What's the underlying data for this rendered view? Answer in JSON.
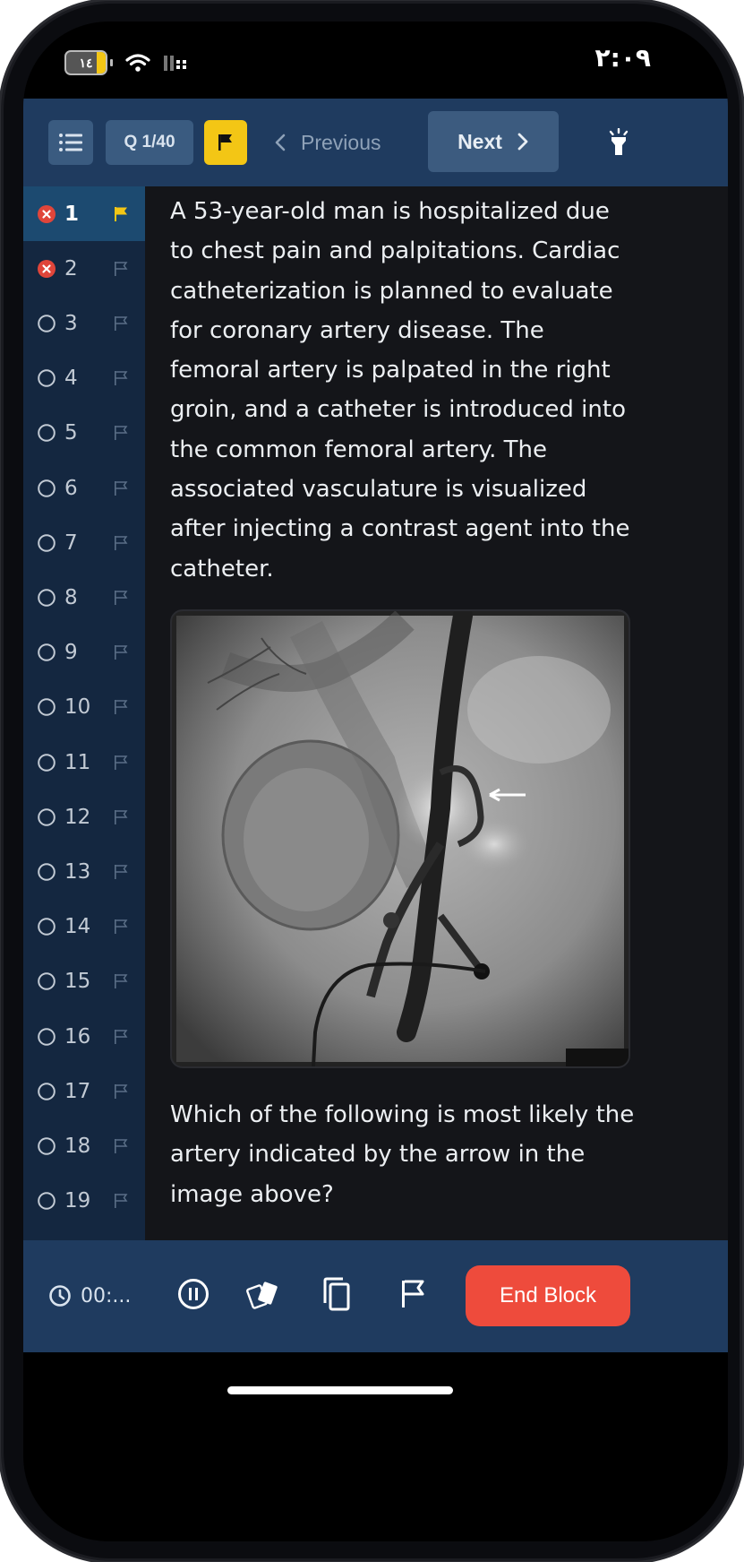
{
  "status_bar": {
    "time": "٢:٠٩",
    "battery_label": "١٤"
  },
  "toolbar": {
    "question_counter": "Q 1/40",
    "previous_label": "Previous",
    "next_label": "Next"
  },
  "sidebar": {
    "items": [
      {
        "number": "1",
        "status": "incorrect",
        "flagged": true,
        "active": true
      },
      {
        "number": "2",
        "status": "incorrect",
        "flagged": false,
        "active": false
      },
      {
        "number": "3",
        "status": "unanswered",
        "flagged": false,
        "active": false
      },
      {
        "number": "4",
        "status": "unanswered",
        "flagged": false,
        "active": false
      },
      {
        "number": "5",
        "status": "unanswered",
        "flagged": false,
        "active": false
      },
      {
        "number": "6",
        "status": "unanswered",
        "flagged": false,
        "active": false
      },
      {
        "number": "7",
        "status": "unanswered",
        "flagged": false,
        "active": false
      },
      {
        "number": "8",
        "status": "unanswered",
        "flagged": false,
        "active": false
      },
      {
        "number": "9",
        "status": "unanswered",
        "flagged": false,
        "active": false
      },
      {
        "number": "10",
        "status": "unanswered",
        "flagged": false,
        "active": false
      },
      {
        "number": "11",
        "status": "unanswered",
        "flagged": false,
        "active": false
      },
      {
        "number": "12",
        "status": "unanswered",
        "flagged": false,
        "active": false
      },
      {
        "number": "13",
        "status": "unanswered",
        "flagged": false,
        "active": false
      },
      {
        "number": "14",
        "status": "unanswered",
        "flagged": false,
        "active": false
      },
      {
        "number": "15",
        "status": "unanswered",
        "flagged": false,
        "active": false
      },
      {
        "number": "16",
        "status": "unanswered",
        "flagged": false,
        "active": false
      },
      {
        "number": "17",
        "status": "unanswered",
        "flagged": false,
        "active": false
      },
      {
        "number": "18",
        "status": "unanswered",
        "flagged": false,
        "active": false
      },
      {
        "number": "19",
        "status": "unanswered",
        "flagged": false,
        "active": false
      }
    ]
  },
  "question": {
    "stem": "A 53-year-old man is hospitalized due to chest pain and palpitations. Cardiac catheterization is planned to evaluate for coronary artery disease. The femoral artery is palpated in the right groin, and a catheter is introduced into the common femoral artery. The associated vasculature is visualized after injecting a contrast agent into the catheter.",
    "prompt": "Which of the following is most likely the artery indicated by the arrow in the image above?"
  },
  "bottom_bar": {
    "timer_label": "00:...",
    "end_block_label": "End Block"
  },
  "colors": {
    "header_bg": "#1f3b5f",
    "sidebar_bg": "#142740",
    "active_row_bg": "#1c4a70",
    "flag_yellow": "#f3c615",
    "incorrect_red": "#e0453a",
    "end_block_red": "#ee4b3c",
    "content_bg": "#141519"
  },
  "icons": [
    "list-icon",
    "flag-icon",
    "chevron-left-icon",
    "chevron-right-icon",
    "flashlight-icon",
    "clock-icon",
    "pause-icon",
    "cards-icon",
    "copy-icon",
    "flag-outline-icon",
    "close-circle-icon",
    "empty-circle-icon"
  ]
}
